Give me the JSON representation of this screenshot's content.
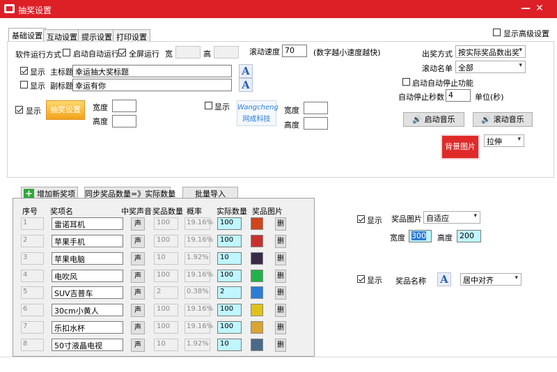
{
  "window": {
    "title": "抽奖设置",
    "min_glyph": "—",
    "close_glyph": "✕"
  },
  "tabs": [
    "基础设置",
    "互动设置",
    "提示设置",
    "打印设置"
  ],
  "show_advanced": "显示高级设置",
  "run_mode": {
    "label": "软件运行方式",
    "auto_run": "启动自动运行",
    "fullscreen": "全屏运行",
    "width_label": "宽",
    "height_label": "高"
  },
  "scroll_speed": {
    "label": "滚动速度",
    "value": "70",
    "hint": "(数字越小速度越快)"
  },
  "main_title": {
    "show": "显示",
    "label": "主标题",
    "value": "幸运抽大奖标题"
  },
  "sub_title": {
    "show": "显示",
    "label": "副标题",
    "value": "幸运有你"
  },
  "logo_left": {
    "show": "显示",
    "image_text": "抽奖设置",
    "width_label": "宽度",
    "height_label": "高度"
  },
  "logo_right": {
    "show": "显示",
    "image_text_top": "Wangcheng",
    "image_text_bottom": "网成科技",
    "width_label": "宽度",
    "height_label": "高度"
  },
  "a_glyph": "A",
  "prize_mode": {
    "label": "出奖方式",
    "value": "按实际奖品数出奖"
  },
  "scroll_list": {
    "label": "滚动名单",
    "value": "全部"
  },
  "auto_stop": {
    "label": "启动自动停止功能",
    "seconds_label": "自动停止秒数",
    "seconds_value": "4",
    "unit": "单位(秒)"
  },
  "music": {
    "start": "启动音乐",
    "scroll": "滚动音乐"
  },
  "bg_image": {
    "label": "背景图片",
    "stretch": "拉伸"
  },
  "actions": {
    "add": "增加新奖项",
    "sync": "同步奖品数量=》实际数量",
    "import": "批量导入"
  },
  "table": {
    "headers": [
      "序号",
      "奖项名",
      "中奖声音",
      "奖品数量",
      "概率",
      "实际数量",
      "奖品图片"
    ],
    "sound_btn": "声",
    "delete_btn": "删",
    "rows": [
      {
        "no": "1",
        "name": "雷诺耳机",
        "qty": "100",
        "prob": "19.16%",
        "real": "100",
        "img": "#d0451b"
      },
      {
        "no": "2",
        "name": "苹果手机",
        "qty": "100",
        "prob": "19.16%",
        "real": "100",
        "img": "#c93030"
      },
      {
        "no": "3",
        "name": "苹果电脑",
        "qty": "10",
        "prob": "1.92%",
        "real": "10",
        "img": "#3a2a4a"
      },
      {
        "no": "4",
        "name": "电吹风",
        "qty": "100",
        "prob": "19.16%",
        "real": "100",
        "img": "#23b24a"
      },
      {
        "no": "5",
        "name": "SUV吉普车",
        "qty": "2",
        "prob": "0.38%",
        "real": "2",
        "img": "#2a7ed8"
      },
      {
        "no": "6",
        "name": "30cm小黄人",
        "qty": "100",
        "prob": "19.16%",
        "real": "100",
        "img": "#e0c21b"
      },
      {
        "no": "7",
        "name": "乐扣水杯",
        "qty": "100",
        "prob": "19.16%",
        "real": "100",
        "img": "#d9a431"
      },
      {
        "no": "8",
        "name": "50寸液晶电视",
        "qty": "10",
        "prob": "1.92%",
        "real": "10",
        "img": "#4a6a8a"
      }
    ]
  },
  "prize_image": {
    "show": "显示",
    "label": "奖品图片",
    "value": "自适应",
    "width_label": "宽度",
    "width_value": "300",
    "height_label": "高度",
    "height_value": "200"
  },
  "prize_name": {
    "show": "显示",
    "label": "奖品名称",
    "align": "居中对齐"
  }
}
